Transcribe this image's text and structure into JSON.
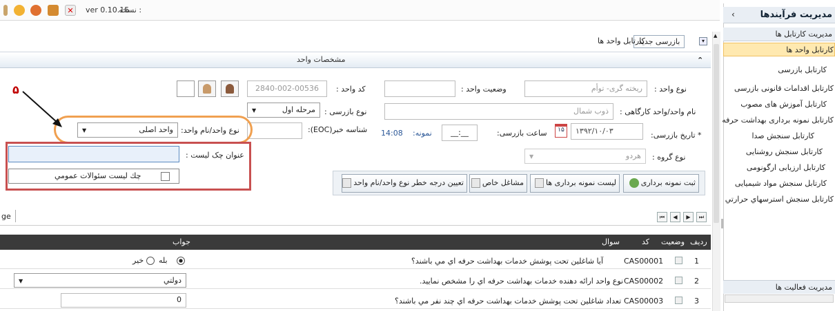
{
  "topbar": {
    "version": "ver 0.10.15",
    "version_label": ": نسخه"
  },
  "tabs": [
    {
      "label": "بازرسی جدید"
    },
    {
      "label": "کارتابل واحد ها"
    }
  ],
  "section": {
    "title": "مشخصات واحد"
  },
  "form": {
    "unit_type_label": "نوع واحد :",
    "unit_type_value": "ریخته گری- توأم",
    "unit_status_label": "وضعیت واحد :",
    "unit_code_label": "کد واحد :",
    "unit_code_value": "2840-002-00536",
    "workshop_name_label": "نام واحد/واحد کارگاهی :",
    "workshop_name_value": "ذوب شمال",
    "inspection_type_label": "نوع بازرسی :",
    "inspection_type_value": "مرحله اول",
    "inspection_date_label": "* تاریخ بازرسی:",
    "inspection_date_value": "۱۳۹۲/۱۰/۰۳",
    "calendar_day": "۱۵",
    "inspection_time_label": "ساعت بازرسی:",
    "inspection_time_value": "__:__",
    "sample_label": "نمونه:",
    "sample_value": "14:08",
    "eoc_label": "شناسه خبر(EOC):",
    "unit_type_name_label": "نوع واحد/نام واحد:",
    "unit_type_name_value": "واحد اصلی",
    "group_type_label": "نوع گروه :",
    "group_type_value": "هردو",
    "checklist_title_label": "عنوان چک لیست :",
    "checklist_option": "چك ليست سئوالات عمومي"
  },
  "annotation": {
    "number": "۵"
  },
  "toolbar": {
    "btn_sampling": "ثبت نمونه برداری",
    "btn_sampling_list": "لیست نمونه برداری ها",
    "btn_special_jobs": "مشاغل خاص",
    "btn_risk": "تعیین درجه خطر نوع واحد/نام واحد"
  },
  "pager": {
    "page_label": "ge"
  },
  "grid": {
    "headers": {
      "row": "ردیف",
      "status": "وضعیت",
      "code": "کد",
      "question": "سوال",
      "answer": "جواب"
    },
    "rows": [
      {
        "num": "1",
        "code": "CAS00001",
        "question": "آيا شاغلين تحت پوشش خدمات بهداشت حرفه اي مي باشند؟",
        "answer_yes": "بله",
        "answer_no": "خير"
      },
      {
        "num": "2",
        "code": "CAS00002",
        "question": "نوع واحد ارائه دهنده خدمات بهداشت حرفه اي را مشخص نماييد.",
        "answer_select": "دولتي"
      },
      {
        "num": "3",
        "code": "CAS00003",
        "question": "تعداد شاغلين تحت پوشش خدمات بهداشت حرفه اي چند نفر مي باشند؟",
        "answer_input": "0"
      }
    ]
  },
  "sidebar": {
    "title": "مدیریت فرآیندها",
    "section1": "مدیریت کارتابل ها",
    "items": [
      {
        "label": "کارتابل واحد ها"
      },
      {
        "label": "کارتابل بازرسی"
      },
      {
        "label": "کارتابل اقدامات قانونی بازرسی"
      },
      {
        "label": "کارتابل آموزش های مصوب"
      },
      {
        "label": "کارتابل نمونه برداری بهداشت حرفه"
      },
      {
        "label": "کارتابل سنجش صدا"
      },
      {
        "label": "کارتابل سنجش روشنایی"
      },
      {
        "label": "کارتابل ارزیابی ارگونومی"
      },
      {
        "label": "کارتابل سنجش مواد شیمیایی"
      },
      {
        "label": "کارتابل  سنجش استرسهاي حرارتي"
      }
    ],
    "section2": "مدیریت فعالیت ها"
  },
  "colors": {
    "accent": "#2b5797",
    "orange": "#f0a050",
    "red": "#c85050",
    "highlight": "#ffe9b0"
  }
}
